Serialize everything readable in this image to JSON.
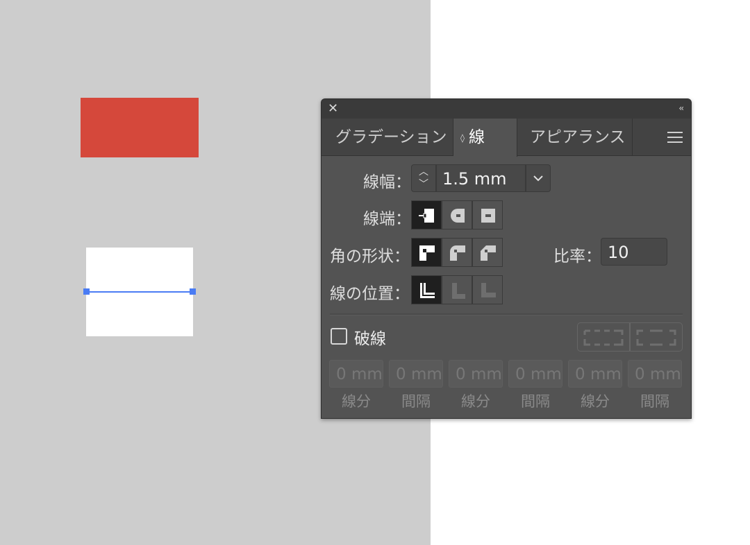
{
  "panel": {
    "close_glyph": "✕",
    "collapse_glyph": "‹‹",
    "tabs": [
      "グラデーション",
      "線",
      "アピアランス"
    ],
    "stroke_tab_icon": "◊"
  },
  "stroke": {
    "weight_label": "線幅：",
    "weight_value": "1.5 mm",
    "cap_label": "線端：",
    "corner_label": "角の形状：",
    "limit_label": "比率：",
    "limit_value": "10",
    "align_label": "線の位置：",
    "dashed_label": "破線",
    "dashed_checked": false,
    "dash_fields": [
      {
        "value": "0 mm",
        "label": "線分"
      },
      {
        "value": "0 mm",
        "label": "間隔"
      },
      {
        "value": "0 mm",
        "label": "線分"
      },
      {
        "value": "0 mm",
        "label": "間隔"
      },
      {
        "value": "0 mm",
        "label": "線分"
      },
      {
        "value": "0 mm",
        "label": "間隔"
      }
    ]
  },
  "colors": {
    "canvas_gray": "#cdcdcd",
    "red_shape": "#d5483b",
    "selection_blue": "#4a7cf4",
    "panel_bg": "#535353"
  },
  "icons": {
    "caps": [
      "butt-cap-icon",
      "round-cap-icon",
      "projecting-cap-icon"
    ],
    "joins": [
      "miter-join-icon",
      "round-join-icon",
      "bevel-join-icon"
    ],
    "align": [
      "align-center-icon",
      "align-inside-icon",
      "align-outside-icon"
    ]
  }
}
